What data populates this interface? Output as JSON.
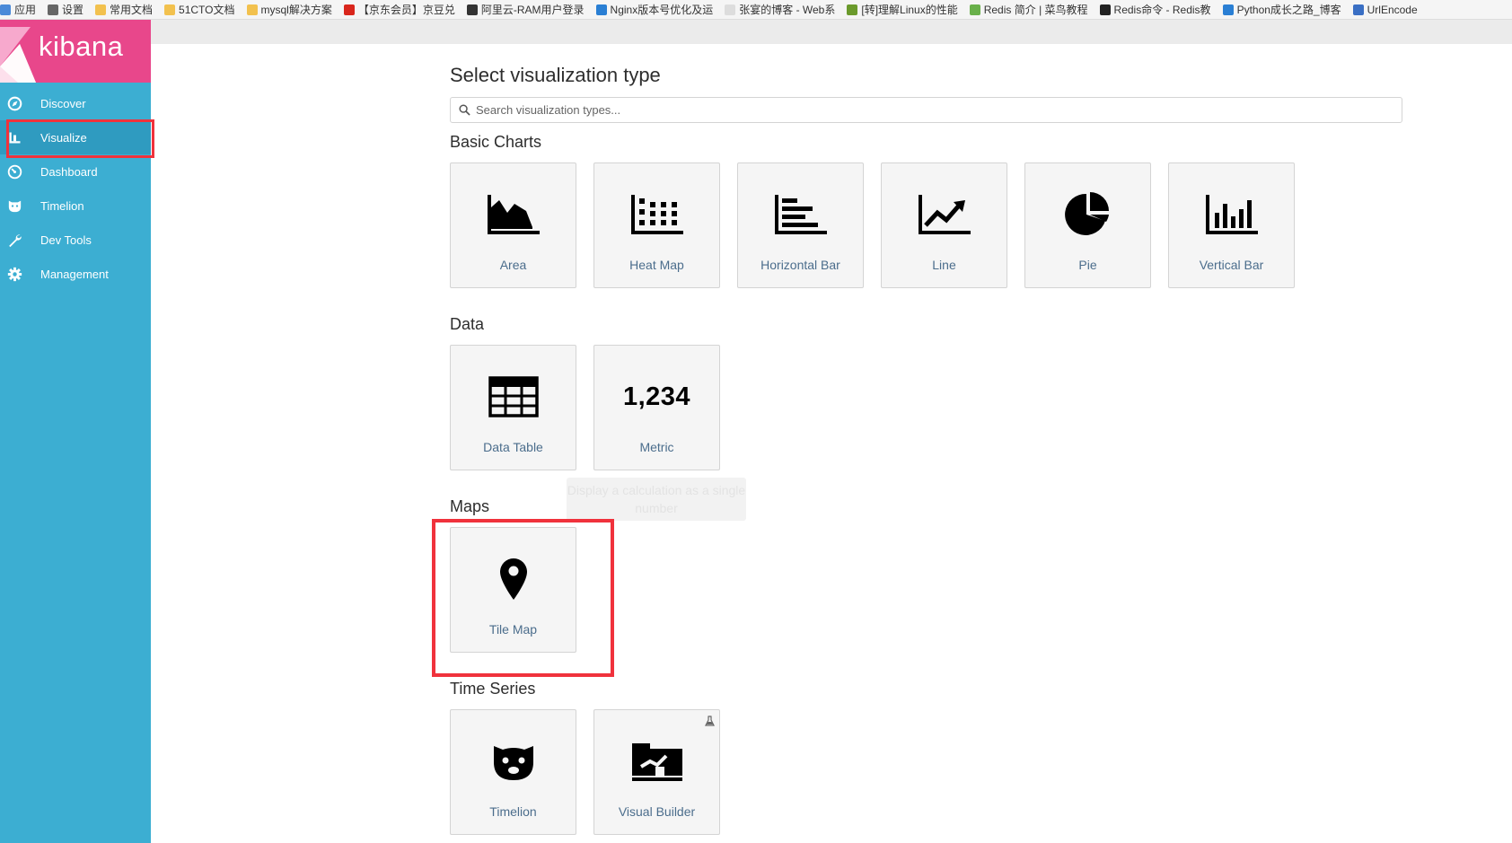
{
  "bookmarks": [
    {
      "label": "应用",
      "color": "#4a8ad8"
    },
    {
      "label": "设置",
      "color": "#666666"
    },
    {
      "label": "常用文档",
      "color": "#f2c14e"
    },
    {
      "label": "51CTO文档",
      "color": "#f2c14e"
    },
    {
      "label": "mysql解决方案",
      "color": "#f2c14e"
    },
    {
      "label": "【京东会员】京豆兑",
      "color": "#d9261c"
    },
    {
      "label": "阿里云-RAM用户登录",
      "color": "#333333"
    },
    {
      "label": "Nginx版本号优化及运",
      "color": "#2a7fd4"
    },
    {
      "label": "张宴的博客 - Web系",
      "color": "#dddddd"
    },
    {
      "label": "[转]理解Linux的性能",
      "color": "#6b9a2c"
    },
    {
      "label": "Redis 简介 | 菜鸟教程",
      "color": "#69b04a"
    },
    {
      "label": "Redis命令 - Redis教",
      "color": "#222222"
    },
    {
      "label": "Python成长之路_博客",
      "color": "#2a7fd4"
    },
    {
      "label": "UrlEncode",
      "color": "#3a6fc4"
    }
  ],
  "logo": {
    "text": "kibana"
  },
  "nav": [
    {
      "label": "Discover",
      "icon": "compass-icon"
    },
    {
      "label": "Visualize",
      "icon": "bar-chart-icon",
      "active": true
    },
    {
      "label": "Dashboard",
      "icon": "speedometer-icon"
    },
    {
      "label": "Timelion",
      "icon": "bear-icon"
    },
    {
      "label": "Dev Tools",
      "icon": "wrench-icon"
    },
    {
      "label": "Management",
      "icon": "gear-icon"
    }
  ],
  "main": {
    "title": "Select visualization type",
    "search_placeholder": "Search visualization types...",
    "sections": {
      "basic": "Basic Charts",
      "data": "Data",
      "maps": "Maps",
      "timeseries": "Time Series"
    },
    "cards": {
      "area": "Area",
      "heatmap": "Heat Map",
      "hbar": "Horizontal Bar",
      "line": "Line",
      "pie": "Pie",
      "vbar": "Vertical Bar",
      "table": "Data Table",
      "metric": "Metric",
      "metric_value": "1,234",
      "tilemap": "Tile Map",
      "timelion": "Timelion",
      "visualbuilder": "Visual Builder"
    },
    "tooltip": "Display a calculation as a single number"
  },
  "colors": {
    "sidebar": "#3caed2",
    "logo_bg": "#e8478b",
    "highlight": "#f0323c",
    "card_label": "#4b6d8c"
  }
}
